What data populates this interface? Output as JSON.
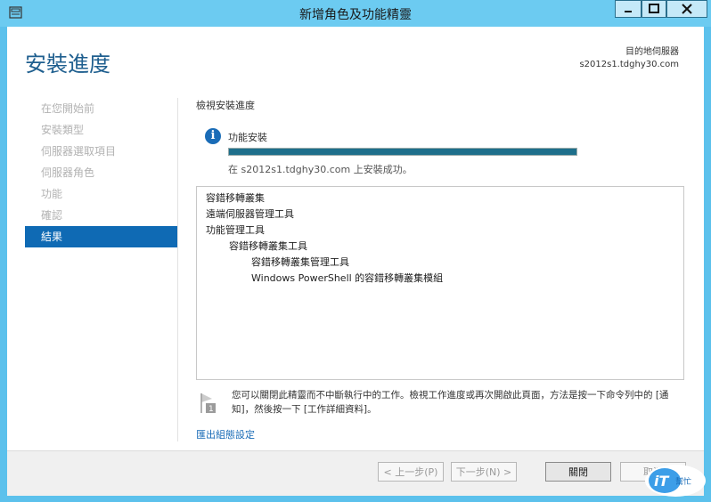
{
  "window": {
    "title": "新增角色及功能精靈"
  },
  "header": {
    "page_title": "安裝進度",
    "dest_label": "目的地伺服器",
    "dest_server": "s2012s1.tdghy30.com"
  },
  "nav": {
    "items": [
      {
        "label": "在您開始前",
        "active": false
      },
      {
        "label": "安裝類型",
        "active": false
      },
      {
        "label": "伺服器選取項目",
        "active": false
      },
      {
        "label": "伺服器角色",
        "active": false
      },
      {
        "label": "功能",
        "active": false
      },
      {
        "label": "確認",
        "active": false
      },
      {
        "label": "結果",
        "active": true
      }
    ]
  },
  "main": {
    "section_title": "檢視安裝進度",
    "status_label": "功能安裝",
    "progress_percent": 100,
    "success_text": "在 s2012s1.tdghy30.com 上安裝成功。",
    "results": [
      {
        "text": "容錯移轉叢集",
        "level": 0
      },
      {
        "text": "遠端伺服器管理工具",
        "level": 0
      },
      {
        "text": "功能管理工具",
        "level": 1
      },
      {
        "text": "容錯移轉叢集工具",
        "level": 2
      },
      {
        "text": "容錯移轉叢集管理工具",
        "level": 3
      },
      {
        "text": "Windows PowerShell 的容錯移轉叢集模組",
        "level": 3
      }
    ],
    "note_text": "您可以關閉此精靈而不中斷執行中的工作。檢視工作進度或再次開啟此頁面，方法是按一下命令列中的 [通知]，然後按一下 [工作詳細資料]。",
    "note_badge": "1",
    "export_link": "匯出組態設定"
  },
  "footer": {
    "prev_label": "< 上一步(P)",
    "next_label": "下一步(N) >",
    "close_label": "關閉",
    "cancel_label": "取消"
  },
  "watermark": {
    "brand": "iT",
    "text": "幫忙"
  },
  "colors": {
    "accent": "#0f6ab4",
    "titlebar": "#6ccbf1",
    "progress": "#1e6f8b"
  }
}
